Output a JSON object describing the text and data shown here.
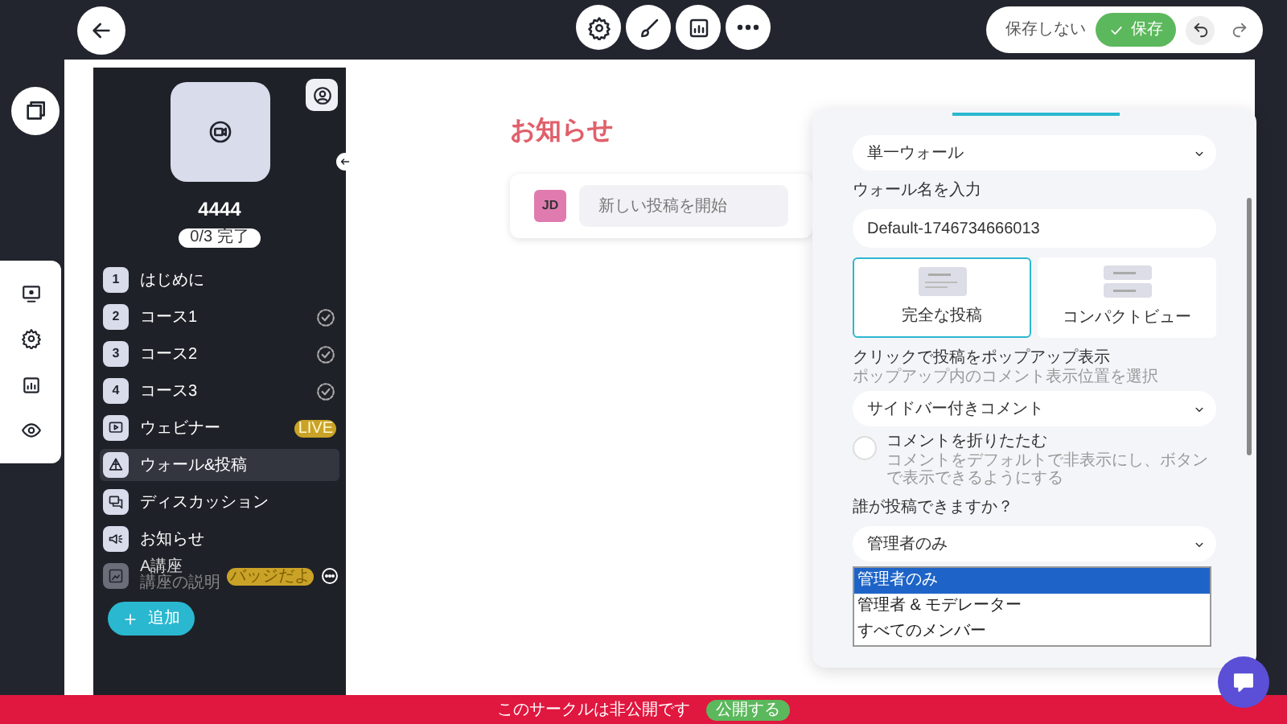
{
  "top_bar": {
    "discard_button": "保存しない",
    "save_button": "保存"
  },
  "sidebar": {
    "title": "4444",
    "progress": "0/3 完了",
    "items": [
      {
        "kind": "number",
        "number": "1",
        "label": "はじめに",
        "selected": false,
        "completion_marker": false
      },
      {
        "kind": "number",
        "number": "2",
        "label": "コース1",
        "selected": false,
        "completion_marker": true
      },
      {
        "kind": "number",
        "number": "3",
        "label": "コース2",
        "selected": false,
        "completion_marker": true
      },
      {
        "kind": "number",
        "number": "4",
        "label": "コース3",
        "selected": false,
        "completion_marker": true
      },
      {
        "kind": "webinar",
        "label": "ウェビナー",
        "badge": "LIVE",
        "selected": false,
        "completion_marker": false
      },
      {
        "kind": "wall",
        "label": "ウォール&投稿",
        "selected": true,
        "completion_marker": false
      },
      {
        "kind": "discussion",
        "label": "ディスカッション",
        "selected": false,
        "completion_marker": false
      },
      {
        "kind": "announcement",
        "label": "お知らせ",
        "selected": false,
        "completion_marker": false
      },
      {
        "kind": "custom",
        "label": "A講座",
        "subtitle": "講座の説明",
        "badge": "バッジだよ",
        "selected": false,
        "completion_marker": false
      }
    ],
    "add_button": "追加"
  },
  "content": {
    "title": "お知らせ",
    "composer": {
      "avatar": "JD",
      "placeholder": "新しい投稿を開始"
    }
  },
  "settings_panel": {
    "wall_type": "単一ウォール",
    "name_label": "ウォール名を入力",
    "name_value": "Default-1746734666013",
    "layouts": [
      {
        "kind": "full",
        "label": "完全な投稿",
        "selected": true
      },
      {
        "kind": "compact",
        "label": "コンパクトビュー",
        "selected": false
      }
    ],
    "popup_label": "クリックで投稿をポップアップ表示",
    "popup_hint": "ポップアップ内のコメント表示位置を選択",
    "popup_value": "サイドバー付きコメント",
    "collapse": {
      "label": "コメントを折りたたむ",
      "hint": "コメントをデフォルトで非表示にし、ボタンで表示できるようにする",
      "checked": false
    },
    "who_label": "誰が投稿できますか？",
    "who_value": "管理者のみ",
    "who_options": [
      {
        "label": "管理者のみ",
        "selected": true
      },
      {
        "label": "管理者 & モデレーター",
        "selected": false
      },
      {
        "label": "すべてのメンバー",
        "selected": false
      }
    ]
  },
  "banner": {
    "text": "このサークルは非公開です",
    "button": "公開する"
  }
}
